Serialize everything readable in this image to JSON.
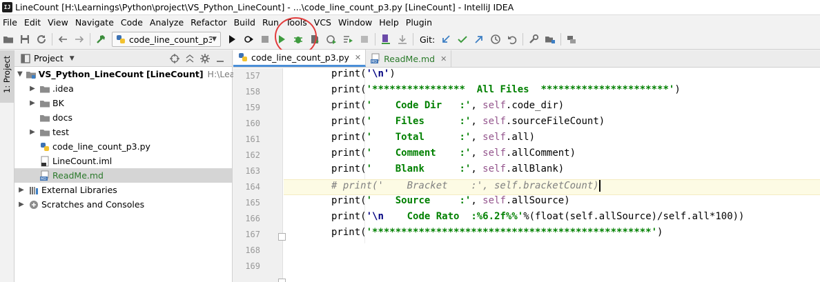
{
  "window": {
    "title": "LineCount [H:\\Learnings\\Python\\project\\VS_Python_LineCount] - ...\\code_line_count_p3.py [LineCount] - IntelliJ IDEA",
    "app_badge": "IJ"
  },
  "menu": [
    "File",
    "Edit",
    "View",
    "Navigate",
    "Code",
    "Analyze",
    "Refactor",
    "Build",
    "Run",
    "Tools",
    "VCS",
    "Window",
    "Help",
    "Plugin"
  ],
  "toolbar": {
    "run_config": "code_line_count_p3",
    "git_label": "Git:"
  },
  "toolstrip": {
    "project_tab": "1: Project"
  },
  "project_panel": {
    "title": "Project",
    "tree": [
      {
        "label": "VS_Python_LineCount",
        "module": "[LineCount]",
        "path": "H:\\Learnings"
      },
      {
        "label": ".idea"
      },
      {
        "label": "BK"
      },
      {
        "label": "docs"
      },
      {
        "label": "test"
      },
      {
        "label": "code_line_count_p3.py"
      },
      {
        "label": "LineCount.iml"
      },
      {
        "label": "ReadMe.md"
      },
      {
        "label": "External Libraries"
      },
      {
        "label": "Scratches and Consoles"
      }
    ]
  },
  "editor": {
    "tabs": [
      {
        "label": "code_line_count_p3.py"
      },
      {
        "label": "ReadMe.md"
      }
    ],
    "line_numbers": [
      "157",
      "158",
      "159",
      "160",
      "161",
      "162",
      "163",
      "164",
      "165",
      "166",
      "167",
      "168",
      "169"
    ],
    "code": {
      "l157_str": "'\\n'",
      "l158_str": "'****************  All Files  **********************'",
      "l159_str": "'    Code Dir   :'",
      "l159_attr": "code_dir",
      "l160_str": "'    Files      :'",
      "l160_attr": "sourceFileCount",
      "l161_str": "'    Total      :'",
      "l161_attr": "all",
      "l162_str": "'    Comment    :'",
      "l162_attr": "allComment",
      "l163_str": "'    Blank      :'",
      "l163_attr": "allBlank",
      "l164_comment": "# print('    Bracket    :', self.bracketCount)",
      "l165_str": "'    Source     :'",
      "l165_attr": "allSource",
      "l166_esc": "'\\n",
      "l166_str": "    Code Rato  :%6.2f%%'",
      "l166_rest": "%(float(self.allSource)/self.all*100))",
      "l167_str": "'************************************************'",
      "kw_print": "print",
      "kw_self": "self"
    }
  },
  "colors": {
    "accent_tab": "#4a8fd8",
    "annotation_circle": "#e23b3b",
    "string_green": "#008000",
    "keyword_navy": "#000080",
    "self_purple": "#94558d"
  }
}
